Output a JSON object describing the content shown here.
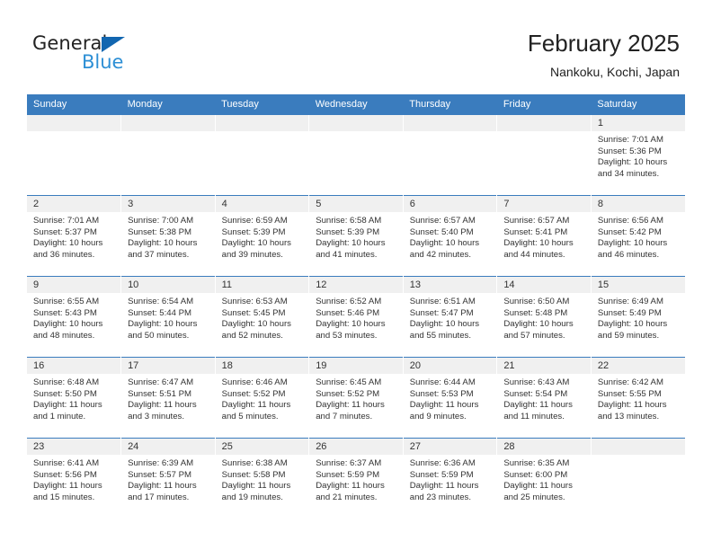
{
  "brand": {
    "name_dark": "General",
    "name_blue": "Blue",
    "accent_blue": "#2d8fd5",
    "triangle_blue": "#1266b0"
  },
  "header": {
    "title": "February 2025",
    "subtitle": "Nankoku, Kochi, Japan",
    "header_bg": "#3a7cbe"
  },
  "weekday_headers": [
    "Sunday",
    "Monday",
    "Tuesday",
    "Wednesday",
    "Thursday",
    "Friday",
    "Saturday"
  ],
  "labels": {
    "sunrise": "Sunrise:",
    "sunset": "Sunset:",
    "daylight": "Daylight:"
  },
  "weeks": [
    [
      {
        "day": "",
        "empty": true
      },
      {
        "day": "",
        "empty": true
      },
      {
        "day": "",
        "empty": true
      },
      {
        "day": "",
        "empty": true
      },
      {
        "day": "",
        "empty": true
      },
      {
        "day": "",
        "empty": true
      },
      {
        "day": "1",
        "sunrise": "Sunrise: 7:01 AM",
        "sunset": "Sunset: 5:36 PM",
        "daylight": "Daylight: 10 hours and 34 minutes."
      }
    ],
    [
      {
        "day": "2",
        "sunrise": "Sunrise: 7:01 AM",
        "sunset": "Sunset: 5:37 PM",
        "daylight": "Daylight: 10 hours and 36 minutes."
      },
      {
        "day": "3",
        "sunrise": "Sunrise: 7:00 AM",
        "sunset": "Sunset: 5:38 PM",
        "daylight": "Daylight: 10 hours and 37 minutes."
      },
      {
        "day": "4",
        "sunrise": "Sunrise: 6:59 AM",
        "sunset": "Sunset: 5:39 PM",
        "daylight": "Daylight: 10 hours and 39 minutes."
      },
      {
        "day": "5",
        "sunrise": "Sunrise: 6:58 AM",
        "sunset": "Sunset: 5:39 PM",
        "daylight": "Daylight: 10 hours and 41 minutes."
      },
      {
        "day": "6",
        "sunrise": "Sunrise: 6:57 AM",
        "sunset": "Sunset: 5:40 PM",
        "daylight": "Daylight: 10 hours and 42 minutes."
      },
      {
        "day": "7",
        "sunrise": "Sunrise: 6:57 AM",
        "sunset": "Sunset: 5:41 PM",
        "daylight": "Daylight: 10 hours and 44 minutes."
      },
      {
        "day": "8",
        "sunrise": "Sunrise: 6:56 AM",
        "sunset": "Sunset: 5:42 PM",
        "daylight": "Daylight: 10 hours and 46 minutes."
      }
    ],
    [
      {
        "day": "9",
        "sunrise": "Sunrise: 6:55 AM",
        "sunset": "Sunset: 5:43 PM",
        "daylight": "Daylight: 10 hours and 48 minutes."
      },
      {
        "day": "10",
        "sunrise": "Sunrise: 6:54 AM",
        "sunset": "Sunset: 5:44 PM",
        "daylight": "Daylight: 10 hours and 50 minutes."
      },
      {
        "day": "11",
        "sunrise": "Sunrise: 6:53 AM",
        "sunset": "Sunset: 5:45 PM",
        "daylight": "Daylight: 10 hours and 52 minutes."
      },
      {
        "day": "12",
        "sunrise": "Sunrise: 6:52 AM",
        "sunset": "Sunset: 5:46 PM",
        "daylight": "Daylight: 10 hours and 53 minutes."
      },
      {
        "day": "13",
        "sunrise": "Sunrise: 6:51 AM",
        "sunset": "Sunset: 5:47 PM",
        "daylight": "Daylight: 10 hours and 55 minutes."
      },
      {
        "day": "14",
        "sunrise": "Sunrise: 6:50 AM",
        "sunset": "Sunset: 5:48 PM",
        "daylight": "Daylight: 10 hours and 57 minutes."
      },
      {
        "day": "15",
        "sunrise": "Sunrise: 6:49 AM",
        "sunset": "Sunset: 5:49 PM",
        "daylight": "Daylight: 10 hours and 59 minutes."
      }
    ],
    [
      {
        "day": "16",
        "sunrise": "Sunrise: 6:48 AM",
        "sunset": "Sunset: 5:50 PM",
        "daylight": "Daylight: 11 hours and 1 minute."
      },
      {
        "day": "17",
        "sunrise": "Sunrise: 6:47 AM",
        "sunset": "Sunset: 5:51 PM",
        "daylight": "Daylight: 11 hours and 3 minutes."
      },
      {
        "day": "18",
        "sunrise": "Sunrise: 6:46 AM",
        "sunset": "Sunset: 5:52 PM",
        "daylight": "Daylight: 11 hours and 5 minutes."
      },
      {
        "day": "19",
        "sunrise": "Sunrise: 6:45 AM",
        "sunset": "Sunset: 5:52 PM",
        "daylight": "Daylight: 11 hours and 7 minutes."
      },
      {
        "day": "20",
        "sunrise": "Sunrise: 6:44 AM",
        "sunset": "Sunset: 5:53 PM",
        "daylight": "Daylight: 11 hours and 9 minutes."
      },
      {
        "day": "21",
        "sunrise": "Sunrise: 6:43 AM",
        "sunset": "Sunset: 5:54 PM",
        "daylight": "Daylight: 11 hours and 11 minutes."
      },
      {
        "day": "22",
        "sunrise": "Sunrise: 6:42 AM",
        "sunset": "Sunset: 5:55 PM",
        "daylight": "Daylight: 11 hours and 13 minutes."
      }
    ],
    [
      {
        "day": "23",
        "sunrise": "Sunrise: 6:41 AM",
        "sunset": "Sunset: 5:56 PM",
        "daylight": "Daylight: 11 hours and 15 minutes."
      },
      {
        "day": "24",
        "sunrise": "Sunrise: 6:39 AM",
        "sunset": "Sunset: 5:57 PM",
        "daylight": "Daylight: 11 hours and 17 minutes."
      },
      {
        "day": "25",
        "sunrise": "Sunrise: 6:38 AM",
        "sunset": "Sunset: 5:58 PM",
        "daylight": "Daylight: 11 hours and 19 minutes."
      },
      {
        "day": "26",
        "sunrise": "Sunrise: 6:37 AM",
        "sunset": "Sunset: 5:59 PM",
        "daylight": "Daylight: 11 hours and 21 minutes."
      },
      {
        "day": "27",
        "sunrise": "Sunrise: 6:36 AM",
        "sunset": "Sunset: 5:59 PM",
        "daylight": "Daylight: 11 hours and 23 minutes."
      },
      {
        "day": "28",
        "sunrise": "Sunrise: 6:35 AM",
        "sunset": "Sunset: 6:00 PM",
        "daylight": "Daylight: 11 hours and 25 minutes."
      },
      {
        "day": "",
        "empty": true
      }
    ]
  ]
}
